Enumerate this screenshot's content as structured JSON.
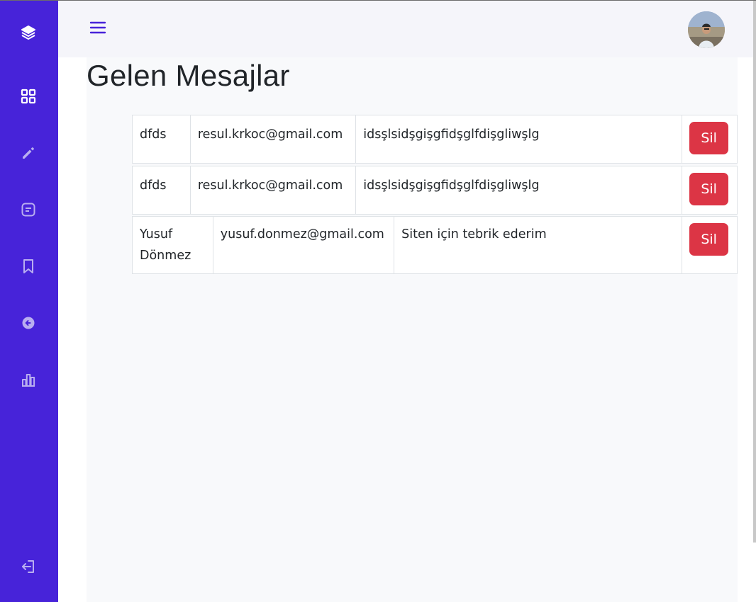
{
  "page": {
    "title": "Gelen Mesajlar"
  },
  "colors": {
    "sidebar": "#4723d9",
    "delete_button": "#dc3545",
    "header_bg": "#f5f5fa"
  },
  "sidebar": {
    "items": [
      {
        "icon": "layers-icon"
      },
      {
        "icon": "dashboard-grid-icon"
      },
      {
        "icon": "pencil-icon"
      },
      {
        "icon": "message-icon"
      },
      {
        "icon": "bookmark-icon"
      },
      {
        "icon": "arrow-left-circle-icon"
      },
      {
        "icon": "bar-chart-icon"
      },
      {
        "icon": "logout-icon"
      }
    ]
  },
  "messages": [
    {
      "name": "dfds",
      "email": "resul.krkoc@gmail.com",
      "message": "idsşlsidşgişgfidşglfdişgliwşlg",
      "delete_label": "Sil"
    },
    {
      "name": "dfds",
      "email": "resul.krkoc@gmail.com",
      "message": "idsşlsidşgişgfidşglfdişgliwşlg",
      "delete_label": "Sil"
    },
    {
      "name": "Yusuf Dönmez",
      "email": "yusuf.donmez@gmail.com",
      "message": "Siten için tebrik ederim",
      "delete_label": "Sil"
    }
  ]
}
